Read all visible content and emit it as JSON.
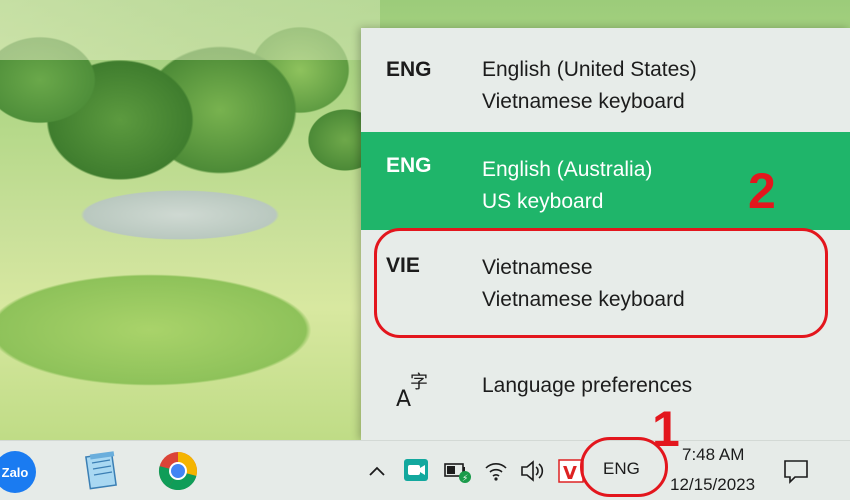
{
  "language_menu": {
    "items": [
      {
        "code": "ENG",
        "name": "English (United States)",
        "keyboard": "Vietnamese keyboard",
        "selected": false
      },
      {
        "code": "ENG",
        "name": "English (Australia)",
        "keyboard": "US keyboard",
        "selected": true
      },
      {
        "code": "VIE",
        "name": "Vietnamese",
        "keyboard": "Vietnamese keyboard",
        "selected": false
      }
    ],
    "preferences_label": "Language preferences",
    "preferences_icon": "language-preferences-icon",
    "selected_color": "#1fb56a"
  },
  "annotations": {
    "step1": "1",
    "step2": "2",
    "color": "#e3161d"
  },
  "taskbar": {
    "apps": [
      {
        "name": "Zalo",
        "icon": "zalo-icon",
        "label": "Zalo"
      },
      {
        "name": "Notepad",
        "icon": "notepad-icon"
      },
      {
        "name": "Google Chrome",
        "icon": "chrome-icon"
      }
    ],
    "tray_icons": [
      "chevron-up-icon",
      "meet-now-icon",
      "battery-icon",
      "wifi-icon",
      "volume-icon",
      "unikey-icon"
    ],
    "unikey_letter": "V",
    "input_indicator": "ENG",
    "clock": {
      "time": "7:48 AM",
      "date": "12/15/2023"
    },
    "action_center_icon": "notification-icon"
  }
}
